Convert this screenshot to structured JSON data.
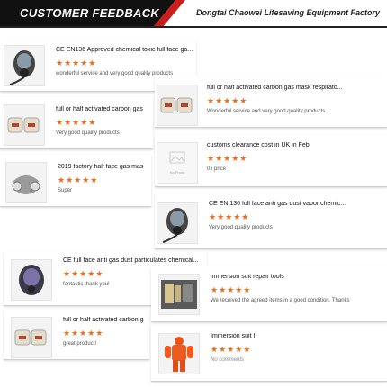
{
  "header": {
    "title": "CUSTOMER FEEDBACK",
    "company": "Dongtai Chaowei Lifesaving Equipment Factory"
  },
  "stars_text": "★★★★★",
  "colors": {
    "star": "#f36b18",
    "banner": "#111111",
    "accent": "#c8201c"
  },
  "reviews": [
    {
      "product": "CE EN136 Approved chemical toxic full face ga...",
      "comment": "wonderful service and very good quality products",
      "image": "full-face-gas-mask"
    },
    {
      "product": "full or half activated carbon gas mask respirato...",
      "comment": "Wonderful service and very good quality products",
      "image": "carbon-filter-cartridges"
    },
    {
      "product": "full or half activated carbon gas",
      "comment": "Very good quality products",
      "image": "carbon-filter-cartridges"
    },
    {
      "product": "customs clearance cost in UK in Feb",
      "comment": "0x price",
      "image": "no-photo-placeholder",
      "placeholder_text": "No Photo"
    },
    {
      "product": "2019 factory half face gas mas",
      "comment": "Super",
      "image": "half-face-respirator"
    },
    {
      "product": "CE EN 136 full face anti gas dust vapor chemic...",
      "comment": "Very good quality products",
      "image": "full-face-gas-mask"
    },
    {
      "product": "CE full face anti gas dust particulates chemical...",
      "comment": "fantastic thank you!",
      "image": "full-face-gas-mask-purple"
    },
    {
      "product": "immersion suit repair tools",
      "comment": "We received the agreed items in a good condition. Thanks",
      "image": "repair-tools-box"
    },
    {
      "product": "full or half activated carbon g",
      "comment": "great product!",
      "image": "carbon-filter-cartridges"
    },
    {
      "product": "Immersion suit I",
      "comment": "No comments",
      "image": "orange-immersion-suit"
    }
  ]
}
